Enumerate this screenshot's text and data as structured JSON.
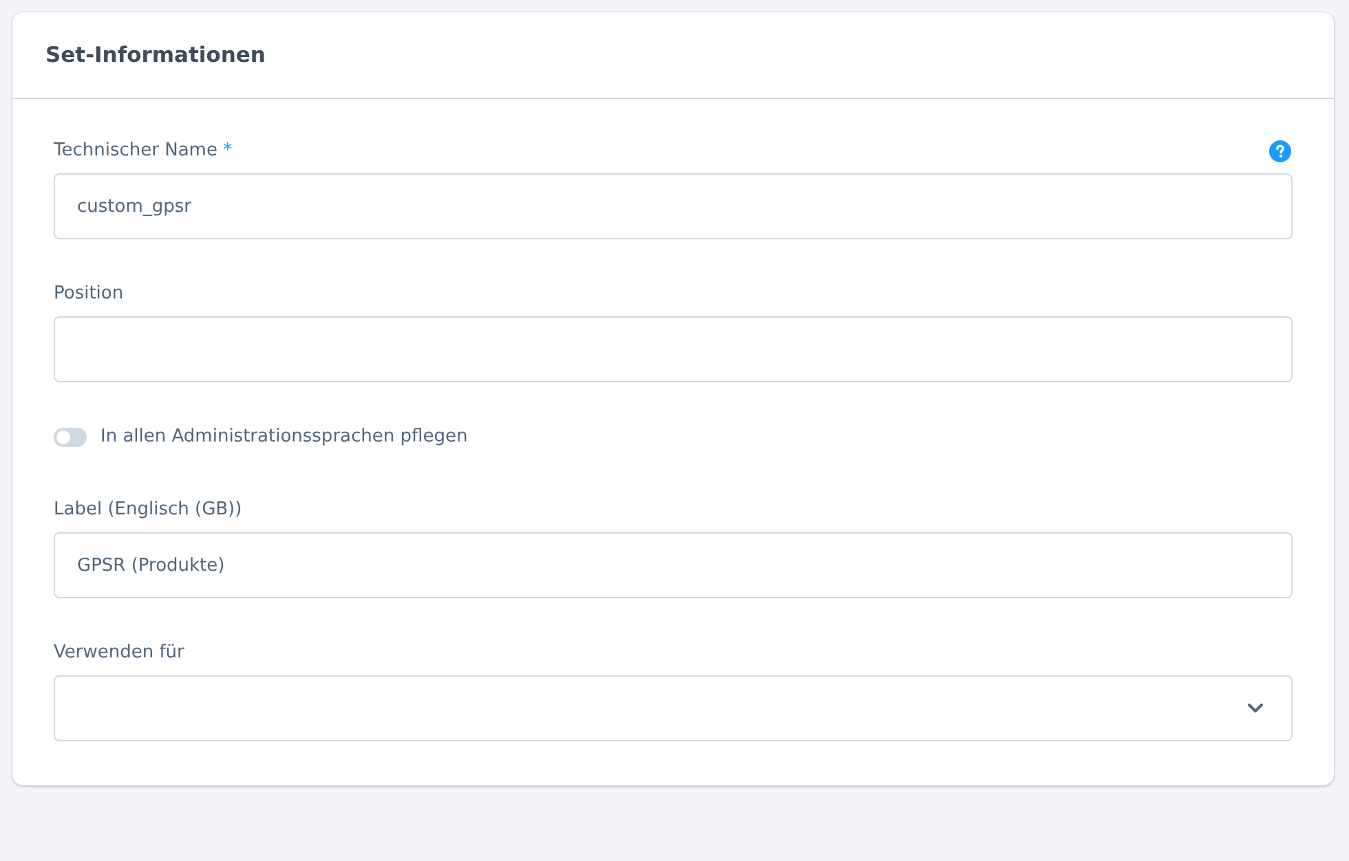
{
  "card": {
    "title": "Set-Informationen"
  },
  "fields": [
    {
      "kind": "text",
      "label": "Technischer Name",
      "required_mark": "*",
      "help": true,
      "value": "custom_gpsr"
    },
    {
      "kind": "text",
      "label": "Position",
      "help": false
    },
    {
      "kind": "toggle",
      "label": "In allen Administrationssprachen pflegen",
      "on": false
    },
    {
      "kind": "text",
      "label": "Label (Englisch (GB))",
      "help": false,
      "value": "GPSR (Produkte)"
    },
    {
      "kind": "select",
      "label": "Verwenden für",
      "help": false
    }
  ]
}
